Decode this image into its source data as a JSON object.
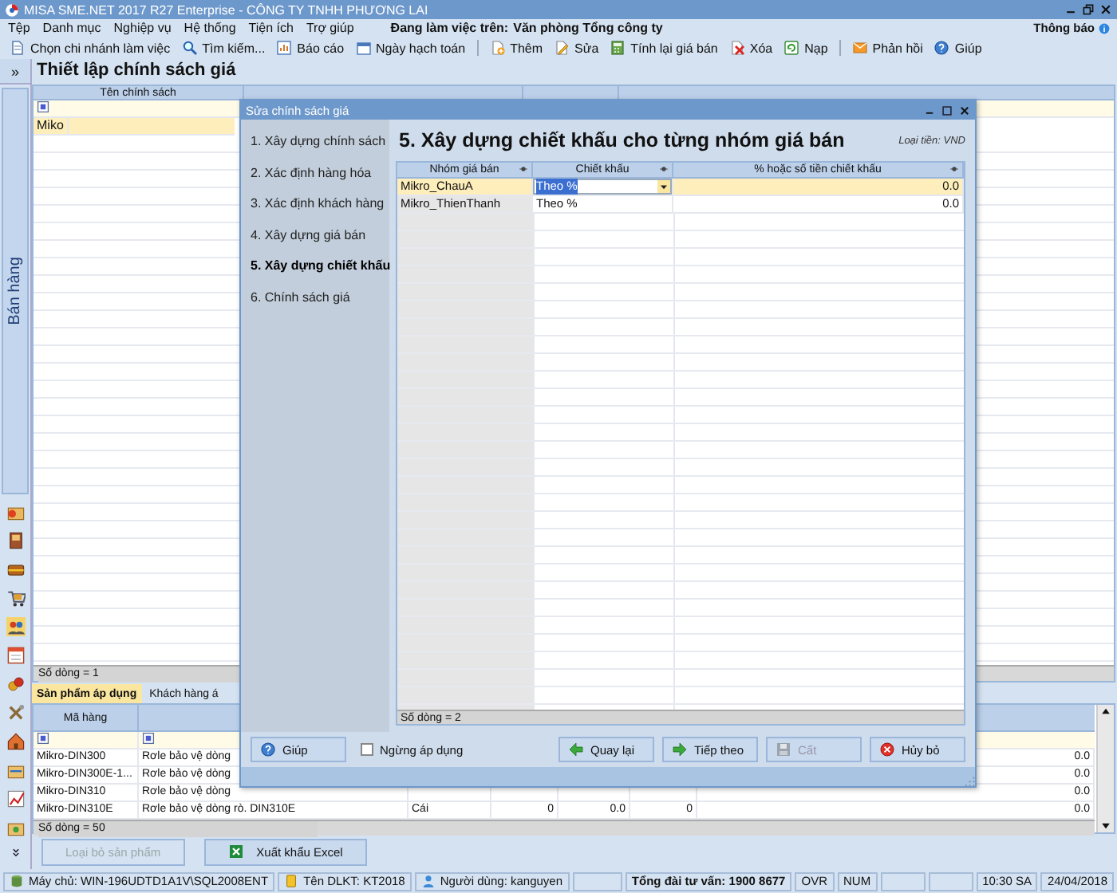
{
  "window": {
    "title": "MISA SME.NET 2017 R27 Enterprise - CÔNG TY TNHH PHƯƠNG LAI"
  },
  "menu": {
    "items": [
      "Tệp",
      "Danh mục",
      "Nghiệp vụ",
      "Hệ thống",
      "Tiện ích",
      "Trợ giúp"
    ],
    "workplace_label": "Đang làm việc trên:",
    "workplace": "Văn phòng Tổng công ty",
    "notifications": "Thông báo"
  },
  "toolbar": [
    [
      "Chọn chi nhánh làm việc",
      "Tìm kiếm...",
      "Báo cáo",
      "Ngày hạch toán"
    ],
    [
      "Thêm",
      "Sửa",
      "Tính lại giá bán",
      "Xóa",
      "Nạp"
    ],
    [
      "Phản hồi",
      "Giúp"
    ]
  ],
  "sidebar": {
    "expand": "»",
    "module": "Bán hàng"
  },
  "page": {
    "title": "Thiết lập chính sách giá",
    "policy_grid": {
      "columns": [
        "Tên chính sách"
      ],
      "rows": [
        {
          "name": "Miko",
          "selected": true
        }
      ],
      "row_count": "Số dòng = 1"
    },
    "detail_tabs": [
      {
        "label": "Sản phẩm áp dụng",
        "selected": true
      },
      {
        "label": "Khách hàng á",
        "selected": false
      }
    ],
    "product_grid": {
      "columns": [
        "Mã hàng"
      ],
      "rows": [
        {
          "code": "Mikro-DIN300",
          "description": "Rơle bảo vệ dòng",
          "column_7": "0.0"
        },
        {
          "code": "Mikro-DIN300E-1...",
          "description": "Rơle bảo vệ dòng",
          "column_7": "0.0"
        },
        {
          "code": "Mikro-DIN310",
          "description": "Rơle bảo vệ dòng",
          "column_7": "0.0"
        },
        {
          "code": "Mikro-DIN310E",
          "description": "Rơle bảo vệ dòng rò. DIN310E",
          "unit": "Cái",
          "column_4": "0",
          "column_5": "0.0",
          "column_6": "0",
          "column_7": "0.0"
        }
      ],
      "row_count": "Số dòng = 50"
    },
    "buttons": [
      {
        "label": "Loại bỏ sản phẩm",
        "disabled": true
      },
      {
        "label": "Xuất khẩu Excel",
        "disabled": false
      }
    ]
  },
  "dialog": {
    "title": "Sửa chính sách giá",
    "steps": [
      {
        "label": "1. Xây dựng chính sách",
        "selected": false
      },
      {
        "label": "2. Xác định hàng hóa",
        "selected": false
      },
      {
        "label": "3. Xác định khách hàng",
        "selected": false
      },
      {
        "label": "4. Xây dựng giá bán",
        "selected": false
      },
      {
        "label": "5. Xây dựng chiết khấu",
        "selected": true
      },
      {
        "label": "6. Chính sách giá",
        "selected": false
      }
    ],
    "heading": "5. Xây dựng chiết khấu cho từng nhóm giá bán",
    "currency": "Loại tiền: VND",
    "grid": {
      "columns": [
        "Nhóm giá bán",
        "Chiết khấu",
        "% hoặc số tiền chiết khấu"
      ],
      "rows": [
        {
          "group": "Mikro_ChauA",
          "discount_type": "Theo %",
          "amount": "0.0",
          "selected": true
        },
        {
          "group": "Mikro_ThienThanh",
          "discount_type": "Theo %",
          "amount": "0.0",
          "selected": false
        }
      ],
      "row_count": "Số dòng = 2"
    },
    "help_button": "Giúp",
    "stop_checkbox": {
      "label": "Ngừng áp dụng",
      "checked": false
    },
    "buttons": [
      {
        "label": "Quay lại",
        "disabled": false
      },
      {
        "label": "Tiếp theo",
        "disabled": false
      },
      {
        "label": "Cất",
        "disabled": true
      },
      {
        "label": "Hủy bỏ",
        "disabled": false
      }
    ]
  },
  "status_bar": {
    "server": "Máy chủ: WIN-196UDTD1A1V\\SQL2008ENT",
    "database": "Tên DLKT: KT2018",
    "user": "Người dùng: kanguyen",
    "hotline": "Tổng đài tư vấn: 1900 8677",
    "overwrite": "OVR",
    "num_lock": "NUM",
    "time": "10:30 SA",
    "date": "24/04/2018"
  }
}
